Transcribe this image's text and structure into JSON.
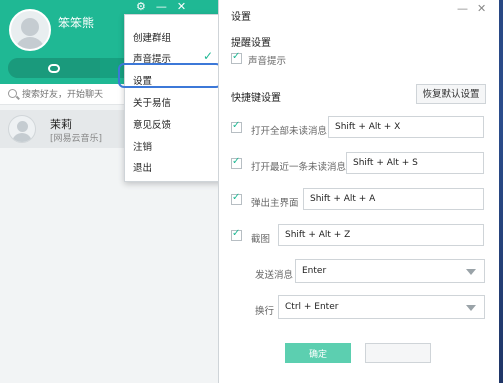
{
  "app": {
    "username": "笨笨熊",
    "window_controls": {
      "settings_glyph": "⚙",
      "minimize": "—",
      "close": "✕"
    },
    "search": {
      "placeholder": "搜索好友，开始聊天"
    },
    "contact": {
      "name": "茉莉",
      "subtitle": "[网易云音乐]"
    }
  },
  "menu": {
    "items": [
      "创建群组",
      "声音提示",
      "设置",
      "关于易信",
      "意见反馈",
      "注销",
      "退出"
    ],
    "checked_item": "声音提示",
    "highlighted_item": "设置"
  },
  "settings": {
    "title": "设置",
    "minimize": "—",
    "close": "✕",
    "reminder_section": "提醒设置",
    "sound_label": "声音提示",
    "shortcut_section": "快捷键设置",
    "restore_button": "恢复默认设置",
    "shortcuts": [
      {
        "label": "打开全部未读消息",
        "keys": "Shift + Alt + X"
      },
      {
        "label": "打开最近一条未读消息",
        "keys": "Shift + Alt + S"
      },
      {
        "label": "弹出主界面",
        "keys": "Shift + Alt + A"
      },
      {
        "label": "截图",
        "keys": "Shift + Alt + Z"
      }
    ],
    "send_label": "发送消息",
    "send_value": "Enter",
    "newline_label": "换行",
    "newline_value": "Ctrl + Enter",
    "ok_button": "确定"
  },
  "colors": {
    "accent": "#1fb894",
    "highlight": "#3c78d8"
  }
}
